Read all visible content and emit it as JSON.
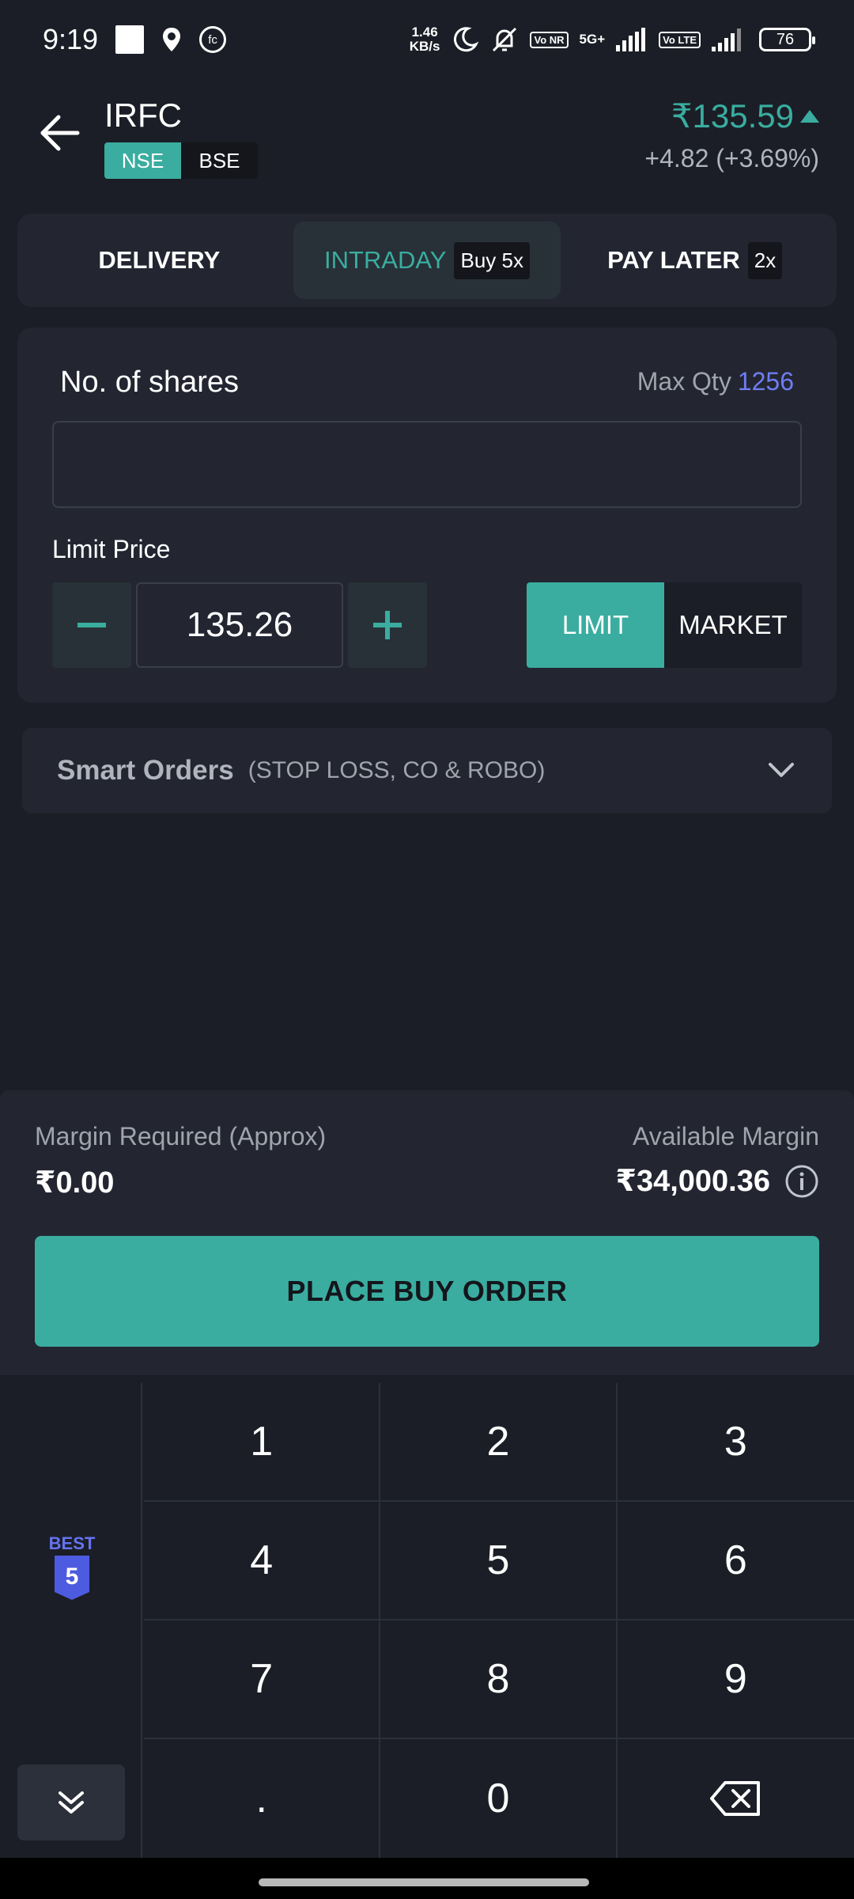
{
  "status_bar": {
    "time": "9:19",
    "net_speed_value": "1.46",
    "net_speed_unit": "KB/s",
    "volte1": "Vo NR",
    "network": "5G+",
    "volte2": "Vo LTE",
    "battery": "76"
  },
  "header": {
    "symbol": "IRFC",
    "exchanges": [
      "NSE",
      "BSE"
    ],
    "active_exchange": "NSE",
    "ltp": "₹135.59",
    "change": "+4.82 (+3.69%)",
    "ltp_color": "#3aada0"
  },
  "order_tabs": [
    {
      "label": "DELIVERY",
      "badge": ""
    },
    {
      "label": "INTRADAY",
      "badge": "Buy 5x"
    },
    {
      "label": "PAY LATER",
      "badge": "2x"
    }
  ],
  "quantity": {
    "label": "No. of shares",
    "max_label": "Max Qty",
    "max_value": "1256",
    "value": ""
  },
  "price": {
    "label": "Limit Price",
    "value": "135.26",
    "minus": "−",
    "plus": "+",
    "types": [
      "LIMIT",
      "MARKET"
    ],
    "selected_type": "LIMIT"
  },
  "smart_orders": {
    "title": "Smart Orders",
    "subtitle": "(STOP LOSS, CO & ROBO)"
  },
  "margin": {
    "required_label": "Margin Required (Approx)",
    "required_value": "₹0.00",
    "available_label": "Available Margin",
    "available_value": "₹34,000.36"
  },
  "place_order": {
    "label": "PLACE BUY ORDER",
    "color": "#3aada0"
  },
  "keypad": {
    "best_label": "BEST",
    "best_value": "5",
    "keys": [
      "1",
      "2",
      "3",
      "4",
      "5",
      "6",
      "7",
      "8",
      "9",
      ".",
      "0"
    ]
  }
}
